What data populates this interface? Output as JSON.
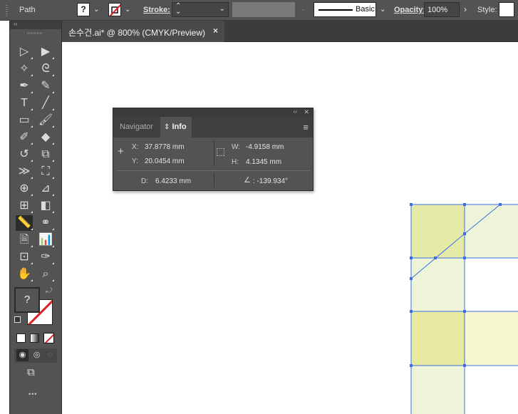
{
  "control_bar": {
    "object_type": "Path",
    "fill_swatch": "?",
    "stroke_label": "Stroke:",
    "stroke_weight": "",
    "brush_name": "Basic",
    "opacity_label": "Opacity:",
    "opacity_value": "100%",
    "style_label": "Style:"
  },
  "document_tab": {
    "title": "손수건.ai* @ 800% (CMYK/Preview)",
    "close_glyph": "×"
  },
  "tools": {
    "collapse_glyph": "‹‹",
    "items": [
      {
        "name": "selection-tool",
        "icon": "selection-arrow-icon",
        "glyph": "▷"
      },
      {
        "name": "direct-selection-tool",
        "icon": "direct-selection-icon",
        "glyph": "▶"
      },
      {
        "name": "magic-wand-tool",
        "icon": "magic-wand-icon",
        "glyph": "✧"
      },
      {
        "name": "lasso-tool",
        "icon": "lasso-icon",
        "glyph": "ᘓ"
      },
      {
        "name": "pen-tool",
        "icon": "pen-icon",
        "glyph": "✒"
      },
      {
        "name": "curvature-tool",
        "icon": "curvature-pen-icon",
        "glyph": "✎"
      },
      {
        "name": "type-tool",
        "icon": "type-icon",
        "glyph": "T"
      },
      {
        "name": "line-segment-tool",
        "icon": "line-icon",
        "glyph": "╱"
      },
      {
        "name": "rectangle-tool",
        "icon": "rectangle-icon",
        "glyph": "▭"
      },
      {
        "name": "paintbrush-tool",
        "icon": "paintbrush-icon",
        "glyph": "🖌"
      },
      {
        "name": "shaper-tool",
        "icon": "shaper-icon",
        "glyph": "✐"
      },
      {
        "name": "eraser-tool",
        "icon": "eraser-icon",
        "glyph": "◆"
      },
      {
        "name": "rotate-tool",
        "icon": "rotate-icon",
        "glyph": "↺"
      },
      {
        "name": "scale-tool",
        "icon": "scale-icon",
        "glyph": "⧉"
      },
      {
        "name": "width-tool",
        "icon": "width-icon",
        "glyph": "≫"
      },
      {
        "name": "free-transform-tool",
        "icon": "free-transform-icon",
        "glyph": "⛶"
      },
      {
        "name": "shape-builder-tool",
        "icon": "shape-builder-icon",
        "glyph": "⊕"
      },
      {
        "name": "perspective-grid-tool",
        "icon": "perspective-grid-icon",
        "glyph": "⊿"
      },
      {
        "name": "mesh-tool",
        "icon": "mesh-icon",
        "glyph": "⊞"
      },
      {
        "name": "gradient-tool",
        "icon": "gradient-icon",
        "glyph": "◧"
      },
      {
        "name": "measure-tool",
        "icon": "ruler-icon",
        "glyph": "📏"
      },
      {
        "name": "blend-tool",
        "icon": "blend-icon",
        "glyph": "⚭"
      },
      {
        "name": "symbol-sprayer-tool",
        "icon": "symbol-sprayer-icon",
        "glyph": "🗎"
      },
      {
        "name": "column-graph-tool",
        "icon": "column-graph-icon",
        "glyph": "📊"
      },
      {
        "name": "artboard-tool",
        "icon": "artboard-icon",
        "glyph": "⊡"
      },
      {
        "name": "eyedropper-tool",
        "icon": "eyedropper-icon",
        "glyph": "✑"
      },
      {
        "name": "hand-tool",
        "icon": "hand-icon",
        "glyph": "✋"
      },
      {
        "name": "zoom-tool",
        "icon": "zoom-icon",
        "glyph": "⌕"
      }
    ],
    "fill_unknown": "?",
    "more_glyph": "•••"
  },
  "info_panel": {
    "collapse_glyph": "‹‹",
    "close_glyph": "✕",
    "tab_navigator": "Navigator",
    "tab_info": "Info",
    "tab_info_arrows": "⇕",
    "menu_glyph": "≡",
    "x_label": "X:",
    "x_value": "37.8778 mm",
    "y_label": "Y:",
    "y_value": "20.0454 mm",
    "w_label": "W:",
    "w_value": "-4.9158 mm",
    "h_label": "H:",
    "h_value": "4.1345 mm",
    "d_label": "D:",
    "d_value": "6.4233 mm",
    "angle_value": ": -139.934°"
  },
  "artwork": {
    "colors": {
      "pale_green": "#eef4d8",
      "mid_green": "#e5eba6",
      "pale_yellow": "#f7f7cd",
      "selection_blue": "#3b6fe0"
    }
  }
}
